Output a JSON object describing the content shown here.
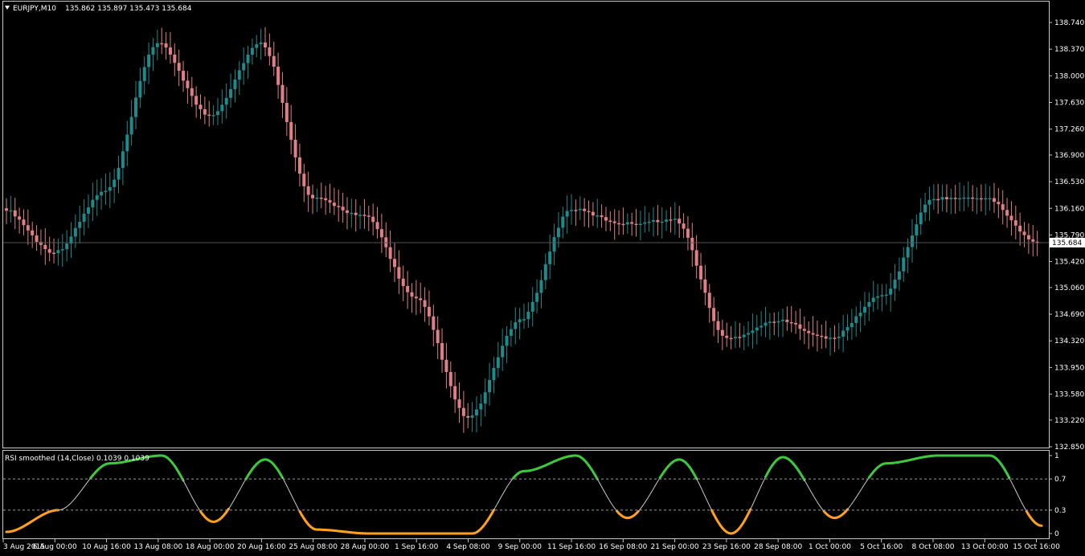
{
  "main": {
    "symbol_label": "EURJPY,M10",
    "ohlc": "135.862 135.897 135.473 135.684",
    "price_min": 132.85,
    "price_max": 138.74,
    "current_price": "135.684",
    "price_ticks": [
      "138.740",
      "138.370",
      "138.000",
      "137.630",
      "137.260",
      "136.900",
      "136.530",
      "136.160",
      "135.790",
      "135.420",
      "135.060",
      "134.690",
      "134.320",
      "133.950",
      "133.580",
      "133.220",
      "132.850"
    ]
  },
  "indicator": {
    "label": "RSI smoothed (14,Close) 0.1039 0.1039",
    "levels": [
      "1",
      "0.7",
      "0.3",
      "0"
    ]
  },
  "time_axis": {
    "labels": [
      "3 Aug 2015",
      "6 Aug 00:00",
      "10 Aug 16:00",
      "13 Aug 08:00",
      "18 Aug 00:00",
      "20 Aug 16:00",
      "25 Aug 08:00",
      "28 Aug 00:00",
      "1 Sep 16:00",
      "4 Sep 08:00",
      "9 Sep 00:00",
      "11 Sep 16:00",
      "16 Sep 08:00",
      "21 Sep 00:00",
      "23 Sep 16:00",
      "28 Sep 08:00",
      "1 Oct 00:00",
      "5 Oct 16:00",
      "8 Oct 08:00",
      "13 Oct 00:00",
      "15 Oct 16:00"
    ]
  },
  "colors": {
    "background": "#000000",
    "bull": "#1d8b8b",
    "bear": "#e07f84",
    "rsi_high": "#3ec83e",
    "rsi_low": "#ffa01e",
    "rsi_mid": "#c8c8c8",
    "grid": "#c8c8c8"
  },
  "chart_data": [
    {
      "type": "line",
      "title": "EURJPY,M10",
      "series": [
        {
          "x": [
            "3 Aug 2015",
            "6 Aug 00:00",
            "10 Aug 16:00",
            "13 Aug 08:00",
            "18 Aug 00:00",
            "20 Aug 16:00",
            "25 Aug 08:00",
            "28 Aug 00:00",
            "1 Sep 16:00",
            "4 Sep 08:00",
            "9 Sep 00:00",
            "11 Sep 16:00",
            "16 Sep 08:00",
            "21 Sep 00:00",
            "23 Sep 16:00",
            "28 Sep 08:00",
            "1 Oct 00:00",
            "5 Oct 16:00",
            "8 Oct 08:00",
            "13 Oct 00:00",
            "15 Oct 16:00"
          ],
          "values": [
            136.16,
            135.55,
            136.4,
            138.45,
            137.45,
            138.45,
            136.3,
            136.05,
            134.9,
            133.25,
            134.6,
            136.15,
            135.95,
            136.0,
            134.35,
            134.6,
            134.35,
            134.95,
            136.3,
            136.3,
            135.68
          ]
        }
      ],
      "ylim": [
        132.85,
        138.74
      ]
    },
    {
      "type": "line",
      "title": "RSI smoothed (14,Close) 0.1039 0.1039",
      "series": [
        {
          "x": [
            "3 Aug 2015",
            "6 Aug 00:00",
            "10 Aug 16:00",
            "13 Aug 08:00",
            "18 Aug 00:00",
            "20 Aug 16:00",
            "25 Aug 08:00",
            "28 Aug 00:00",
            "1 Sep 16:00",
            "4 Sep 08:00",
            "9 Sep 00:00",
            "11 Sep 16:00",
            "16 Sep 08:00",
            "21 Sep 00:00",
            "23 Sep 16:00",
            "28 Sep 08:00",
            "1 Oct 00:00",
            "5 Oct 16:00",
            "8 Oct 08:00",
            "13 Oct 00:00",
            "15 Oct 16:00"
          ],
          "values": [
            0.02,
            0.3,
            0.9,
            1.0,
            0.15,
            0.95,
            0.05,
            0.0,
            0.0,
            0.0,
            0.8,
            1.0,
            0.2,
            0.95,
            0.0,
            0.98,
            0.2,
            0.9,
            1.0,
            1.0,
            0.1
          ]
        }
      ],
      "ylim": [
        0,
        1
      ]
    }
  ]
}
